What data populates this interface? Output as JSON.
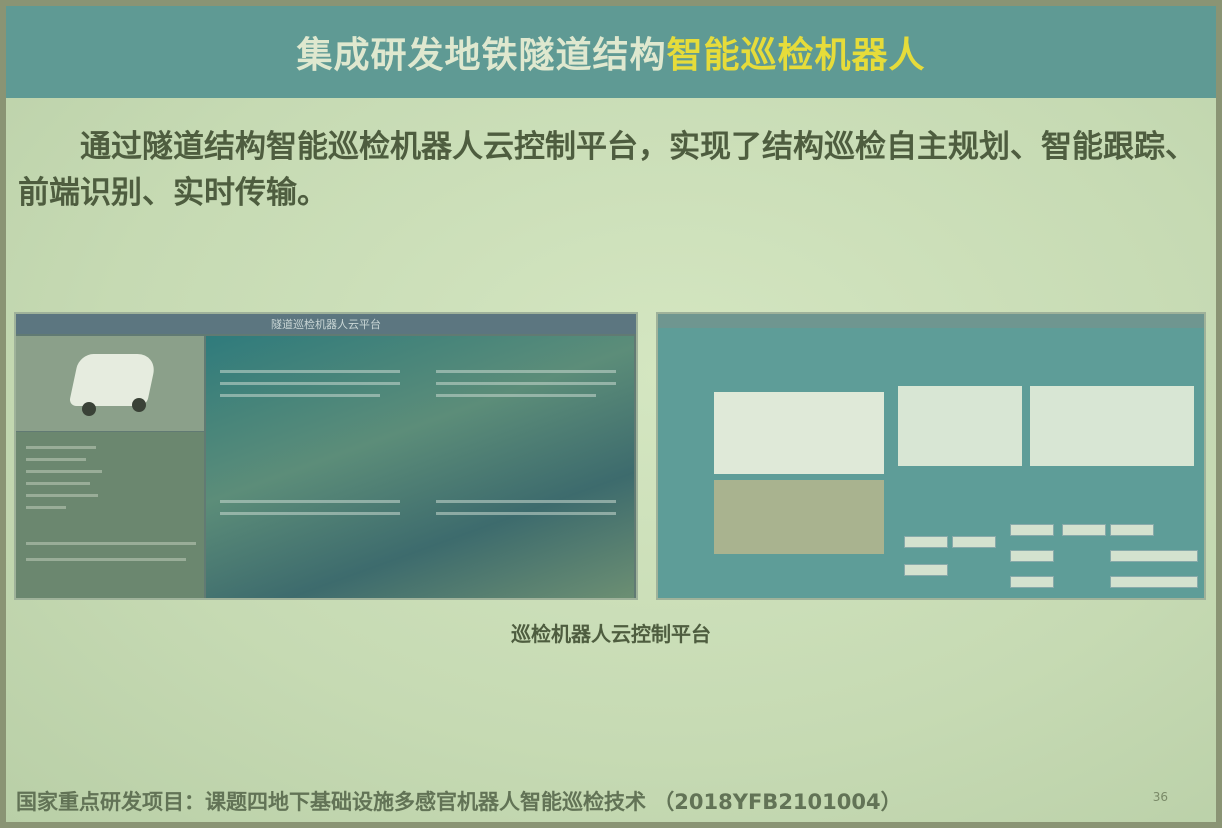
{
  "slide": {
    "title_part1": "集成研发地铁隧道结构",
    "title_part2": "智能巡检机器人",
    "body": "通过隧道结构智能巡检机器人云控制平台，实现了结构巡检自主规划、智能跟踪、前端识别、实时传输。",
    "screenshot_left_title": "隧道巡检机器人云平台",
    "caption": "巡检机器人云控制平台",
    "footer": "国家重点研发项目：课题四地下基础设施多感官机器人智能巡检技术 （2018YFB2101004）",
    "page_number": "36"
  },
  "colors": {
    "title_bar": "#5f9a94",
    "title_highlight": "#e6dc3a",
    "slide_background": "#c8dcb5",
    "body_text": "#4e5d3f"
  }
}
